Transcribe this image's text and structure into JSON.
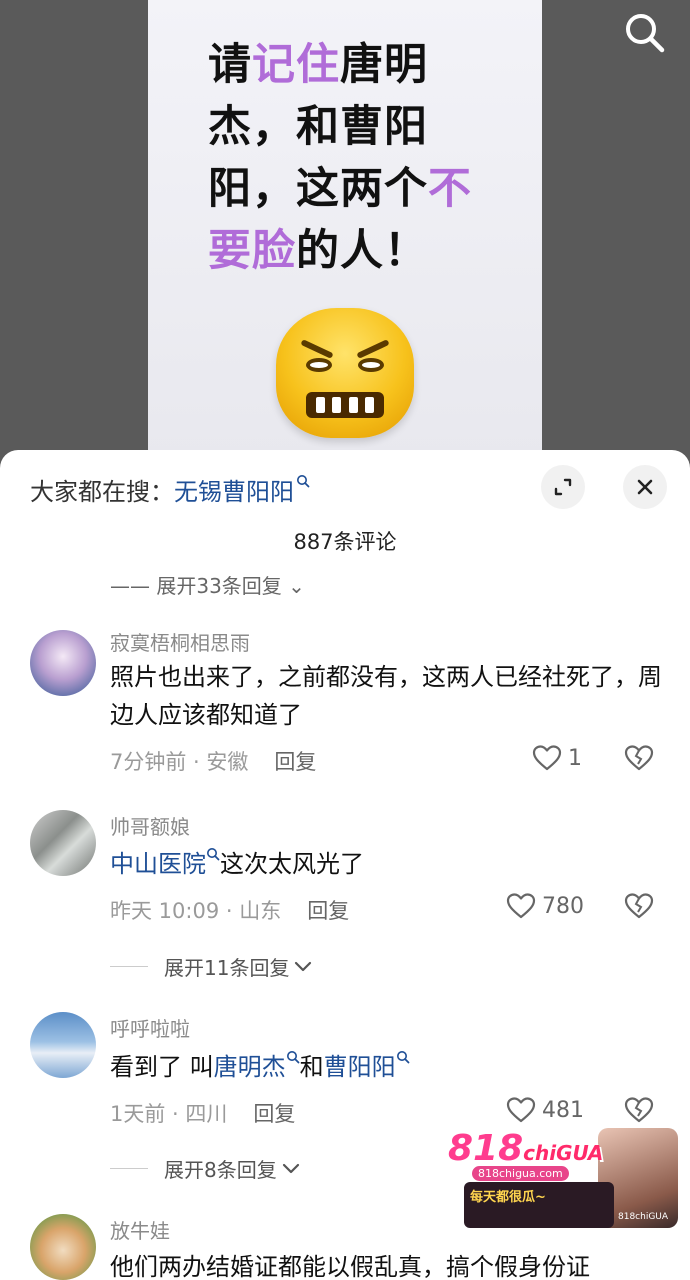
{
  "video": {
    "overlay_lines": [
      [
        {
          "t": "请",
          "c": "dark"
        },
        {
          "t": "记住",
          "c": "purple"
        },
        {
          "t": "唐明",
          "c": "dark"
        }
      ],
      [
        {
          "t": "杰，和曹阳",
          "c": "dark"
        }
      ],
      [
        {
          "t": "阳，这两个",
          "c": "dark"
        },
        {
          "t": "不",
          "c": "purple"
        }
      ],
      [
        {
          "t": "要脸",
          "c": "purple"
        },
        {
          "t": "的人！",
          "c": "dark"
        }
      ]
    ]
  },
  "sheet": {
    "search_prefix": "大家都在搜：",
    "search_keyword": "无锡曹阳阳",
    "comment_count": "887条评论",
    "partial_expand": "—— 展开33条回复 ⌄"
  },
  "comments": [
    {
      "username": "寂寞梧桐相思雨",
      "text": "照片也出来了，之前都没有，这两人已经社死了，周边人应该都知道了",
      "time_location": "7分钟前 · 安徽",
      "reply_label": "回复",
      "likes": "1"
    },
    {
      "username": "帅哥额娘",
      "link": "中山医院",
      "text": "这次太风光了",
      "time_location": "昨天 10:09 · 山东",
      "reply_label": "回复",
      "likes": "780",
      "expand_replies": "展开11条回复"
    },
    {
      "username": "呼呼啦啦",
      "text_prefix": "看到了 叫",
      "link1": "唐明杰",
      "middle": "和",
      "link2": "曹阳阳",
      "time_location": "1天前 · 四川",
      "reply_label": "回复",
      "likes": "481",
      "expand_replies": "展开8条回复"
    },
    {
      "username": "放牛娃",
      "text": "他们两办结婚证都能以假乱真，搞个假身份证"
    }
  ],
  "watermark": {
    "logo": "818",
    "logo_suffix": "chiGUA",
    "url": "818chigua.com",
    "slogan": "每天都很瓜~",
    "tag": "818chiGUA"
  },
  "colors": {
    "link": "#1f4f96",
    "purple_text": "#b06cd8",
    "muted": "#8a8a8a"
  }
}
